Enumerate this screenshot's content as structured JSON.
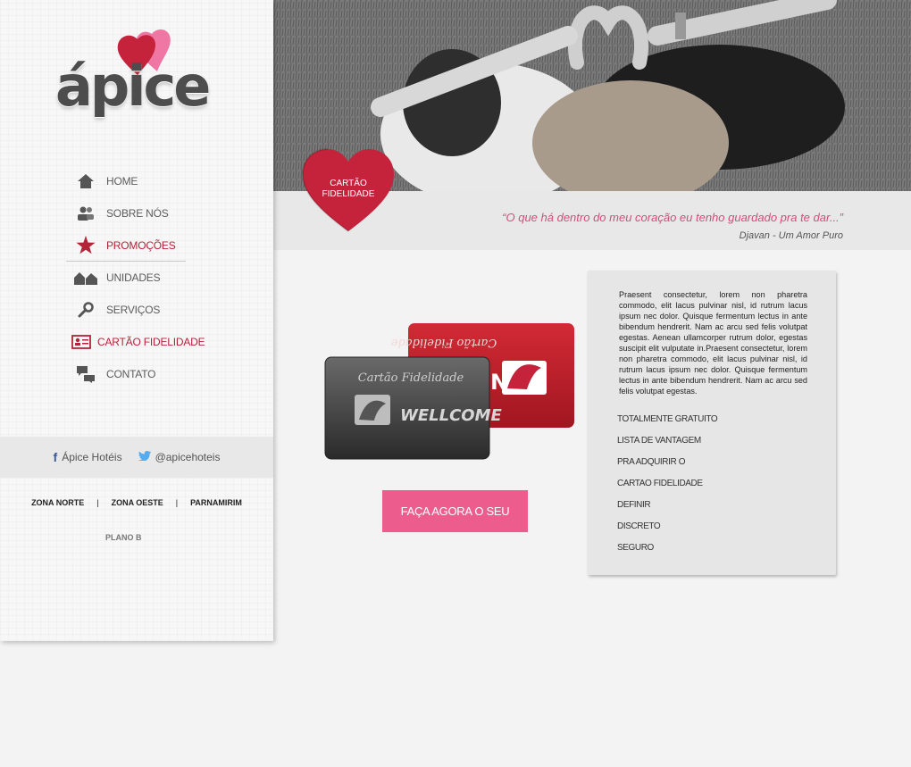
{
  "brand": {
    "name": "ápice"
  },
  "nav": [
    {
      "label": "HOME",
      "icon": "home-icon"
    },
    {
      "label": "SOBRE NÓS",
      "icon": "people-icon"
    },
    {
      "label": "PROMOÇÕES",
      "icon": "star-icon",
      "active": true
    },
    {
      "label": "UNIDADES",
      "icon": "buildings-icon"
    },
    {
      "label": "SERVIÇOS",
      "icon": "tools-icon"
    },
    {
      "label": "CARTÃO FIDELIDADE",
      "icon": "id-card-icon",
      "active": true
    },
    {
      "label": "CONTATO",
      "icon": "chat-icon"
    }
  ],
  "social": {
    "facebook": "Ápice Hotéis",
    "twitter": "@apicehoteis"
  },
  "zones": [
    "ZONA NORTE",
    "ZONA OESTE",
    "PARNAMIRIM"
  ],
  "zone_separator": "|",
  "plano": "PLANO B",
  "badge": {
    "line1": "CARTÃO",
    "line2": "FIDELIDADE"
  },
  "quote": {
    "text": "“O que há dentro do meu coração eu tenho guardado pra te dar...”",
    "author": "Djavan - Um Amor Puro"
  },
  "cards": {
    "front_title": "Cartão Fidelidade",
    "front_brand": "WELLCOME",
    "back_title": "Cartão Fidelidade",
    "back_brand": "N"
  },
  "cta": "FAÇA AGORA O SEU",
  "info": {
    "text": "Praesent consectetur, lorem non pharetra commodo, elit lacus pulvinar nisl, id rutrum lacus ipsum nec dolor. Quisque fermentum lectus in ante bibendum hendrerit. Nam ac arcu sed felis volutpat egestas. Aenean ullamcorper rutrum dolor, egestas suscipit elit vulputate in.Praesent consectetur, lorem non pharetra commodo, elit lacus pulvinar nisl, id rutrum lacus ipsum nec dolor. Quisque fermentum lectus in ante bibendum hendrerit. Nam ac arcu sed felis volutpat egestas.",
    "features": [
      "TOTALMENTE GRATUITO",
      "LISTA DE VANTAGEM",
      "PRA ADQUIRIR O",
      "CARTAO FIDELIDADE",
      "DEFINIR",
      "DISCRETO",
      "SEGURO"
    ]
  },
  "colors": {
    "accent": "#b3243a",
    "pink": "#ec5d8d",
    "heart": "#c4233b"
  }
}
